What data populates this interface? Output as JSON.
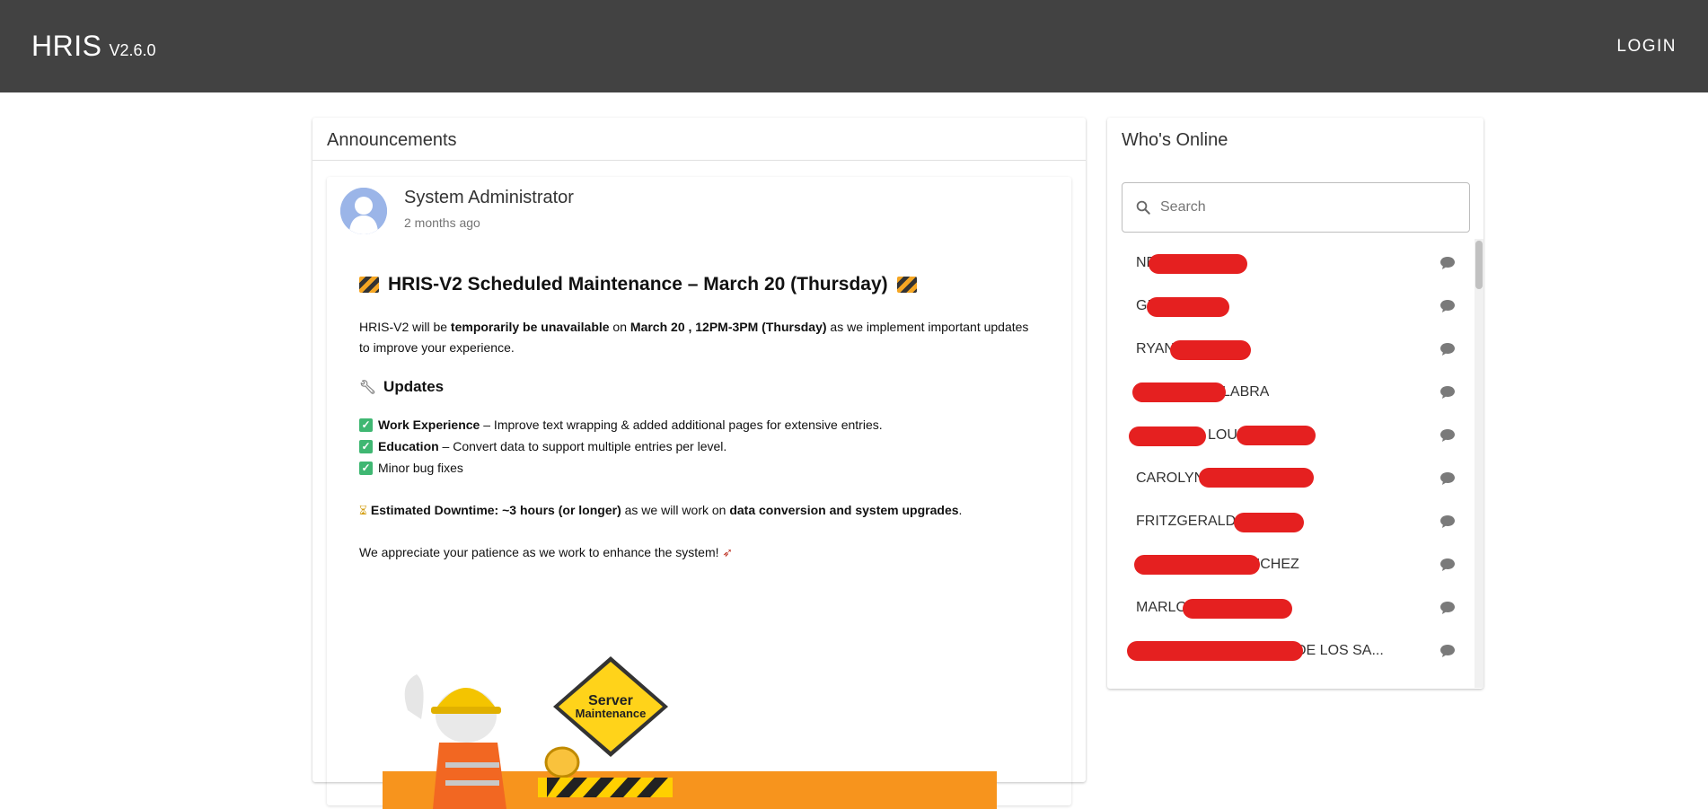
{
  "header": {
    "app_name": "HRIS",
    "version": "V2.6.0",
    "login_label": "LOGIN"
  },
  "announcements": {
    "title": "Announcements",
    "post": {
      "author": "System Administrator",
      "time_ago": "2 months ago",
      "headline": "HRIS-V2 Scheduled Maintenance – March 20 (Thursday)",
      "intro_pre": "HRIS-V2 will be ",
      "intro_bold1": "temporarily be unavailable",
      "intro_mid": " on ",
      "intro_bold2": "March 20 , 12PM-3PM (Thursday)",
      "intro_post": " as we implement important updates to improve your experience.",
      "updates_title": "Updates",
      "updates": [
        {
          "bold": "Work Experience",
          "text": " – Improve text wrapping & added additional pages for extensive entries."
        },
        {
          "bold": "Education",
          "text": " – Convert data to support multiple entries per level."
        },
        {
          "bold": "",
          "text": "Minor bug fixes"
        }
      ],
      "downtime_bold": "Estimated Downtime: ~3 hours (or longer)",
      "downtime_mid": " as we will work on ",
      "downtime_bold2": "data conversion and system upgrades",
      "downtime_end": ".",
      "closing": "We appreciate your patience as we work to enhance the system!",
      "image_sign_line1": "Server",
      "image_sign_line2": "Maintenance"
    }
  },
  "online": {
    "title": "Who's Online",
    "search_placeholder": "Search",
    "users": [
      {
        "name": "NE"
      },
      {
        "name": "GI"
      },
      {
        "name": "RYAN"
      },
      {
        "name": "LABRA"
      },
      {
        "name": "LOUIE"
      },
      {
        "name": "CAROLYN"
      },
      {
        "name": "FRITZGERALD"
      },
      {
        "name": "ANCHEZ"
      },
      {
        "name": "MARLO"
      },
      {
        "name": "DE LOS SA..."
      }
    ]
  },
  "colors": {
    "appbar": "#424242",
    "redaction": "#e52020",
    "avatar": "#9bb5e8",
    "check": "#3fb772"
  }
}
